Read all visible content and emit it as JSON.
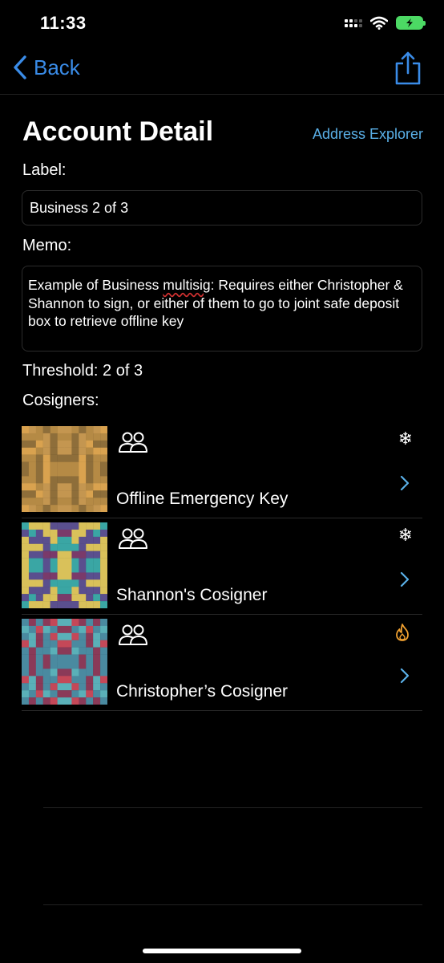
{
  "status_bar": {
    "time": "11:33"
  },
  "nav": {
    "back_label": "Back"
  },
  "header": {
    "title": "Account Detail",
    "address_explorer": "Address Explorer"
  },
  "form": {
    "label_caption": "Label:",
    "label_value": "Business 2 of 3",
    "memo_caption": "Memo:",
    "memo_before": "Example of Business ",
    "memo_misspelled": "multisig",
    "memo_after": ": Requires either Christopher & Shannon to sign, or either of them to go to joint safe deposit box to retrieve offline key"
  },
  "threshold": "Threshold: 2 of 3",
  "cosigners_caption": "Cosigners:",
  "cosigners": [
    {
      "name": "Offline Emergency Key",
      "status_icon": "snowflake-icon",
      "status_glyph": "❄",
      "status_color": "#ffffff",
      "avatar_palette": [
        "#d9a24f",
        "#b58a45",
        "#8e6e3a",
        "#c49650"
      ]
    },
    {
      "name": "Shannon's Cosigner",
      "status_icon": "snowflake-icon",
      "status_glyph": "❄",
      "status_color": "#ffffff",
      "avatar_palette": [
        "#3aa6a4",
        "#5a4f8e",
        "#d9c15a",
        "#7a3a6a"
      ]
    },
    {
      "name": "Christopher’s Cosigner",
      "status_icon": "flame-icon",
      "status_glyph": "",
      "status_color": "#f0a030",
      "avatar_palette": [
        "#5ab0b8",
        "#c44858",
        "#8a3a58",
        "#4a8aa0"
      ]
    }
  ],
  "colors": {
    "accent": "#3a8ce8",
    "link": "#5ab0e8",
    "flame": "#f0a030"
  }
}
